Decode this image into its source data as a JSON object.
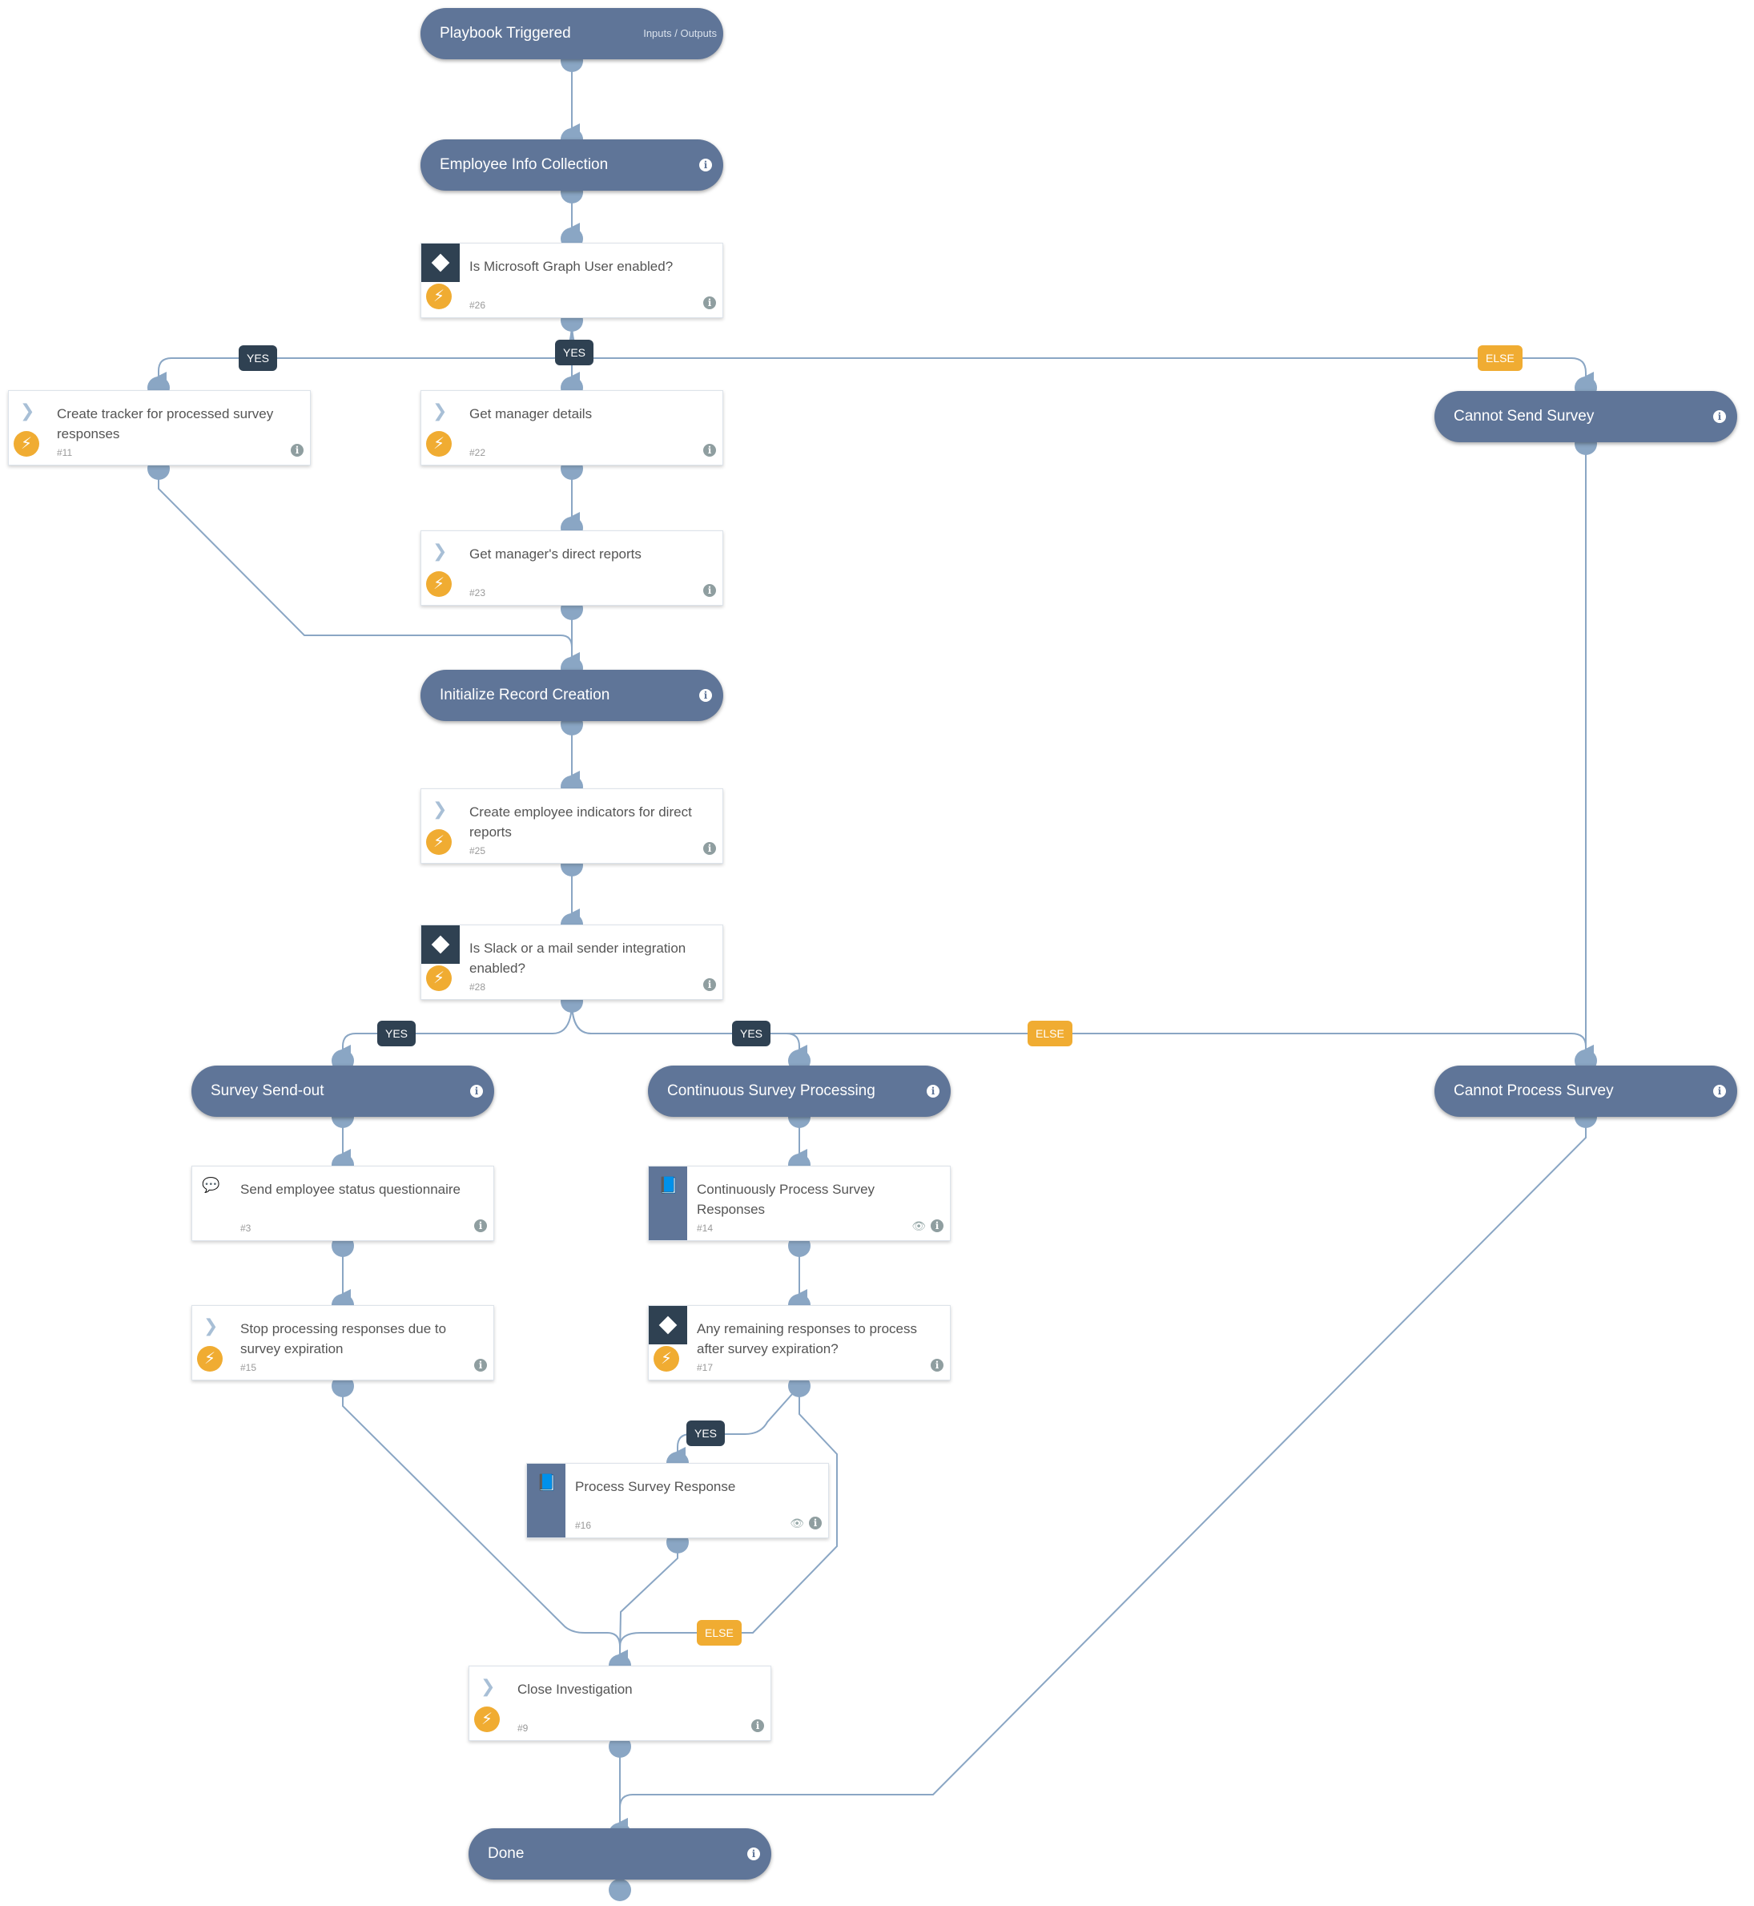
{
  "playbook": {
    "start_node": {
      "title": "Playbook Triggered",
      "io_link": "Inputs / Outputs"
    },
    "section_nodes": [
      {
        "id": "employee-info-collection",
        "title": "Employee Info Collection"
      },
      {
        "id": "cannot-send-survey",
        "title": "Cannot Send Survey"
      },
      {
        "id": "initialize-record-creation",
        "title": "Initialize Record Creation"
      },
      {
        "id": "survey-send-out",
        "title": "Survey Send-out"
      },
      {
        "id": "continuous-survey-processing",
        "title": "Continuous Survey Processing"
      },
      {
        "id": "cannot-process-survey",
        "title": "Cannot Process Survey"
      },
      {
        "id": "done",
        "title": "Done"
      }
    ],
    "task_nodes": [
      {
        "id": "t26",
        "type": "condition",
        "title": "Is Microsoft Graph User enabled?",
        "number": "#26",
        "automated": true
      },
      {
        "id": "t11",
        "type": "automation",
        "title": "Create tracker for processed survey responses",
        "number": "#11",
        "automated": true
      },
      {
        "id": "t22",
        "type": "automation",
        "title": "Get manager details",
        "number": "#22",
        "automated": true
      },
      {
        "id": "t23",
        "type": "automation",
        "title": "Get manager's direct reports",
        "number": "#23",
        "automated": true
      },
      {
        "id": "t25",
        "type": "automation",
        "title": "Create employee indicators for direct reports",
        "number": "#25",
        "automated": true
      },
      {
        "id": "t28",
        "type": "condition",
        "title": "Is Slack or a mail sender integration enabled?",
        "number": "#28",
        "automated": true
      },
      {
        "id": "t3",
        "type": "communication",
        "title": "Send employee status questionnaire",
        "number": "#3",
        "automated": false
      },
      {
        "id": "t14",
        "type": "playbook",
        "title": "Continuously Process Survey Responses",
        "number": "#14",
        "automated": false
      },
      {
        "id": "t15",
        "type": "automation",
        "title": "Stop processing responses due to survey expiration",
        "number": "#15",
        "automated": true
      },
      {
        "id": "t17",
        "type": "condition",
        "title": "Any remaining responses to process after survey expiration?",
        "number": "#17",
        "automated": true
      },
      {
        "id": "t16",
        "type": "playbook",
        "title": "Process Survey Response",
        "number": "#16",
        "automated": false
      },
      {
        "id": "t9",
        "type": "automation",
        "title": "Close Investigation",
        "number": "#9",
        "automated": true
      }
    ],
    "edge_labels": {
      "yes": "YES",
      "else": "ELSE"
    },
    "icons": {
      "info": "i",
      "bolt": "⚡",
      "chevron": "❯",
      "book": "📘",
      "chat": "💬",
      "eye": "👁"
    },
    "colors": {
      "section_node": "#5f7598",
      "condition_header": "#2f4152",
      "automation_badge": "#f0ac32",
      "edge": "#8aa6c4",
      "yes_label": "#2f4152",
      "else_label": "#f0ac32"
    }
  }
}
